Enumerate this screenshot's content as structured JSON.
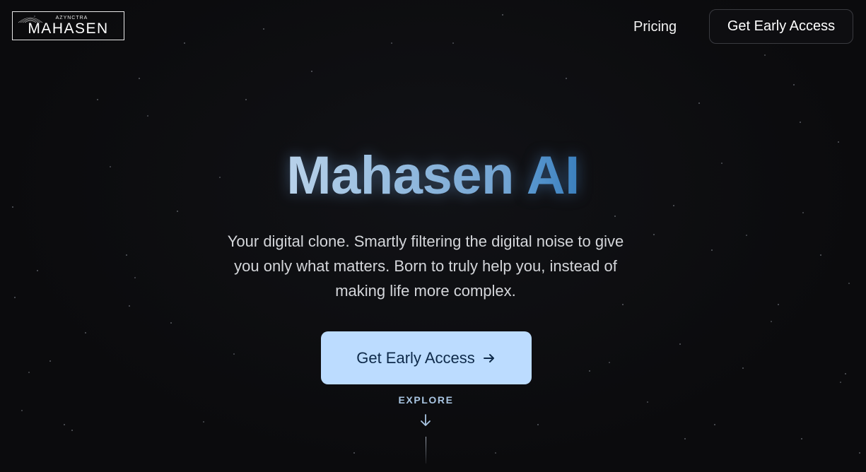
{
  "header": {
    "logo": {
      "brand_small": "AZYNCTRA",
      "brand_main": "MAHASEN"
    },
    "nav": {
      "pricing_label": "Pricing",
      "cta_label": "Get Early Access"
    }
  },
  "hero": {
    "title_part1": "Mahasen",
    "title_part2": "AI",
    "subtitle": "Your digital clone. Smartly filtering the digital noise to give you only what matters. Born to truly help you, instead of making life more complex.",
    "cta_label": "Get Early Access",
    "cta_icon": "arrow-right-icon",
    "explore_label": "EXPLORE",
    "explore_icon": "arrow-down-icon"
  },
  "colors": {
    "background": "#0b0b0d",
    "title_light": "#a9c9e6",
    "title_accent": "#4f8fc7",
    "cta_background": "#bcdcff",
    "cta_text": "#0e2a4a",
    "explore_text": "#a9c5e2"
  }
}
